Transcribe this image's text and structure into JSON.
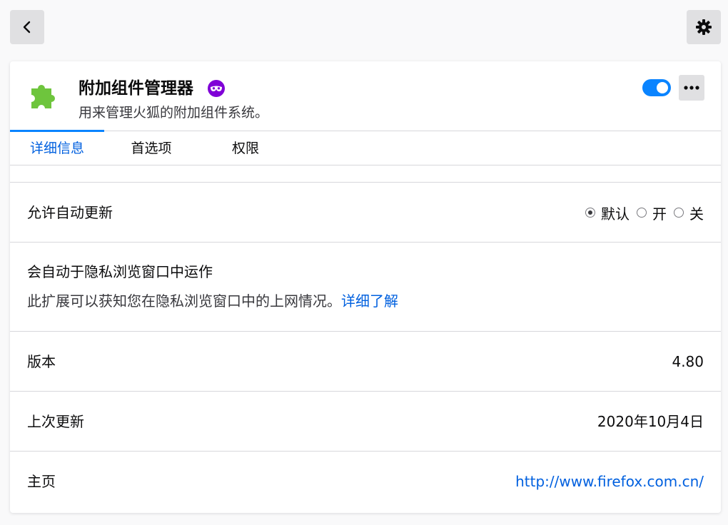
{
  "topbar": {
    "back_icon": "chevron-left-icon",
    "settings_icon": "gear-icon"
  },
  "addon": {
    "name": "附加组件管理器",
    "description": "用来管理火狐的附加组件系统。",
    "icon": "puzzle-piece-icon",
    "icon_color": "#6ec53d",
    "private_badge_icon": "private-browsing-mask-icon",
    "private_badge_color": "#8000d7",
    "enabled": true,
    "toggle_color": "#0a84ff",
    "more_icon": "more-horizontal-icon"
  },
  "tabs": [
    {
      "label": "详细信息",
      "selected": true
    },
    {
      "label": "首选项",
      "selected": false
    },
    {
      "label": "权限",
      "selected": false
    }
  ],
  "auto_update": {
    "label": "允许自动更新",
    "options": [
      {
        "label": "默认",
        "checked": true
      },
      {
        "label": "开",
        "checked": false
      },
      {
        "label": "关",
        "checked": false
      }
    ]
  },
  "private_browsing": {
    "label": "会自动于隐私浏览窗口中运作",
    "description": "此扩展可以获知您在隐私浏览窗口中的上网情况。",
    "learn_more": "详细了解"
  },
  "version": {
    "label": "版本",
    "value": "4.80"
  },
  "last_updated": {
    "label": "上次更新",
    "value": "2020年10月4日"
  },
  "homepage": {
    "label": "主页",
    "value": "http://www.firefox.com.cn/"
  },
  "colors": {
    "link": "#0060df",
    "accent": "#0a84ff"
  }
}
